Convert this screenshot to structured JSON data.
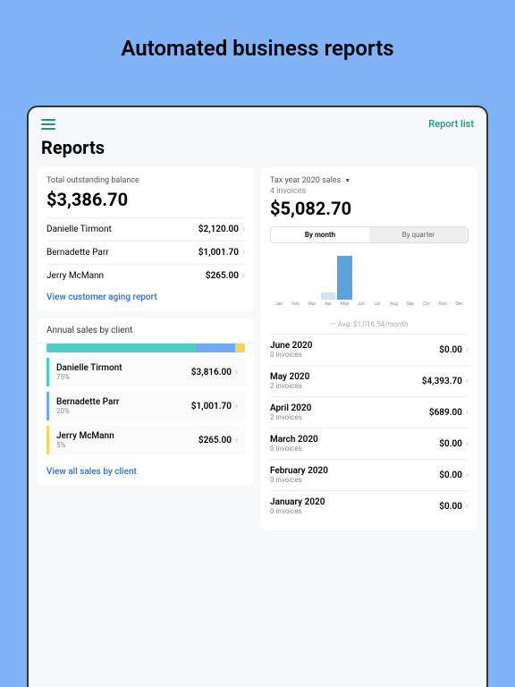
{
  "headline": "Automated business reports",
  "topbar": {
    "report_list": "Report list"
  },
  "title": "Reports",
  "outstanding": {
    "label": "Total outstanding balance",
    "total": "$3,386.70",
    "rows": [
      {
        "name": "Danielle Tirmont",
        "amount": "$2,120.00"
      },
      {
        "name": "Bernadette Parr",
        "amount": "$1,001.70"
      },
      {
        "name": "Jerry McMann",
        "amount": "$265.00"
      }
    ],
    "link": "View customer aging report"
  },
  "annual": {
    "header": "Annual sales by client",
    "bars": [
      75,
      20,
      5
    ],
    "clients": [
      {
        "name": "Danielle Tirmont",
        "pct": "75%",
        "amount": "$3,816.00"
      },
      {
        "name": "Bernadette Parr",
        "pct": "20%",
        "amount": "$1,001.70"
      },
      {
        "name": "Jerry McMann",
        "pct": "5%",
        "amount": "$265.00"
      }
    ],
    "link": "View all sales by client"
  },
  "tax": {
    "dropdown": "Tax year 2020 sales",
    "invoices": "4 invoices",
    "total": "$5,082.70",
    "seg": {
      "month": "By month",
      "quarter": "By quarter"
    },
    "months_axis": [
      "Jan",
      "Feb",
      "Mar",
      "Apr",
      "May",
      "Jun",
      "Jul",
      "Aug",
      "Sep",
      "Oct",
      "Nov",
      "Dec"
    ],
    "avg": "Avg: $1,016.54/month",
    "list": [
      {
        "month": "June 2020",
        "inv": "0 invoices",
        "amount": "$0.00"
      },
      {
        "month": "May 2020",
        "inv": "2 invoices",
        "amount": "$4,393.70"
      },
      {
        "month": "April 2020",
        "inv": "2 invoices",
        "amount": "$689.00"
      },
      {
        "month": "March 2020",
        "inv": "0 invoices",
        "amount": "$0.00"
      },
      {
        "month": "February 2020",
        "inv": "0 invoices",
        "amount": "$0.00"
      },
      {
        "month": "January 2020",
        "inv": "0 invoices",
        "amount": "$0.00"
      }
    ]
  },
  "chart_data": {
    "type": "bar",
    "title": "Tax year 2020 sales",
    "categories": [
      "Jan",
      "Feb",
      "Mar",
      "Apr",
      "May",
      "Jun",
      "Jul",
      "Aug",
      "Sep",
      "Oct",
      "Nov",
      "Dec"
    ],
    "values": [
      0,
      0,
      0,
      689.0,
      4393.7,
      0,
      0,
      0,
      0,
      0,
      0,
      0
    ],
    "xlabel": "",
    "ylabel": "",
    "avg_line": 1016.54,
    "ylim": [
      0,
      5000
    ]
  }
}
